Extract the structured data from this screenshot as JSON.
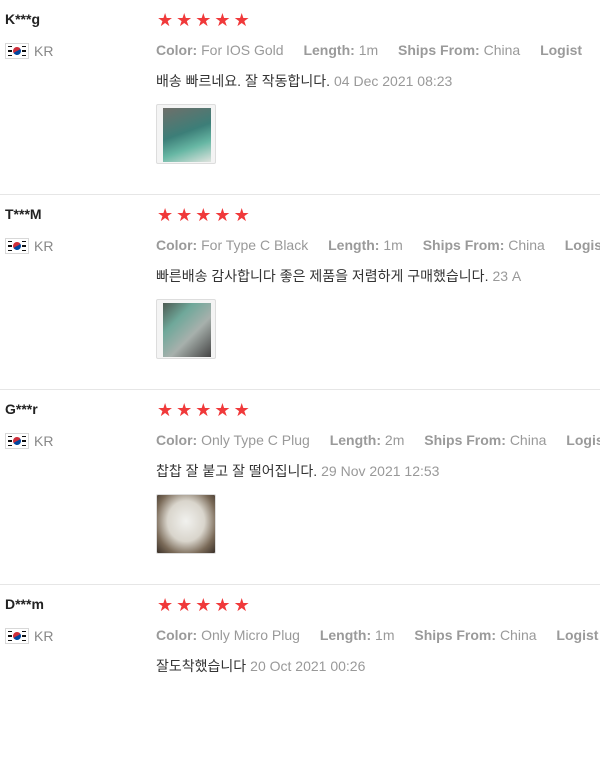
{
  "labels": {
    "color": "Color:",
    "length": "Length:",
    "ships_from": "Ships From:",
    "logistics": "Logist"
  },
  "reviews": [
    {
      "user": "K***g",
      "country": "KR",
      "rating": 5,
      "color": "For IOS Gold",
      "length": "1m",
      "ships_from": "China",
      "content": "배송 빠르네요. 잘 작동합니다.",
      "date": "04 Dec 2021 08:23",
      "photo": "phone-photo"
    },
    {
      "user": "T***M",
      "country": "KR",
      "rating": 5,
      "color": "For Type C Black",
      "length": "1m",
      "ships_from": "China",
      "content": "빠른배송 감사합니다 좋은 제품을 저렴하게 구매했습니다.",
      "date": "23 A",
      "photo": "cable-photo"
    },
    {
      "user": "G***r",
      "country": "KR",
      "rating": 5,
      "color": "Only Type C Plug",
      "length": "2m",
      "ships_from": "China",
      "content": "찹찹 잘 붙고 잘 떨어집니다.",
      "date": "29 Nov 2021 12:53",
      "photo": "car-interior-photo"
    },
    {
      "user": "D***m",
      "country": "KR",
      "rating": 5,
      "color": "Only Micro Plug",
      "length": "1m",
      "ships_from": "China",
      "content": "잘도착했습니다",
      "date": "20 Oct 2021 00:26"
    }
  ],
  "colors": {
    "star": "#f0393a",
    "meta": "#999999",
    "divider": "#e6e6e6"
  }
}
